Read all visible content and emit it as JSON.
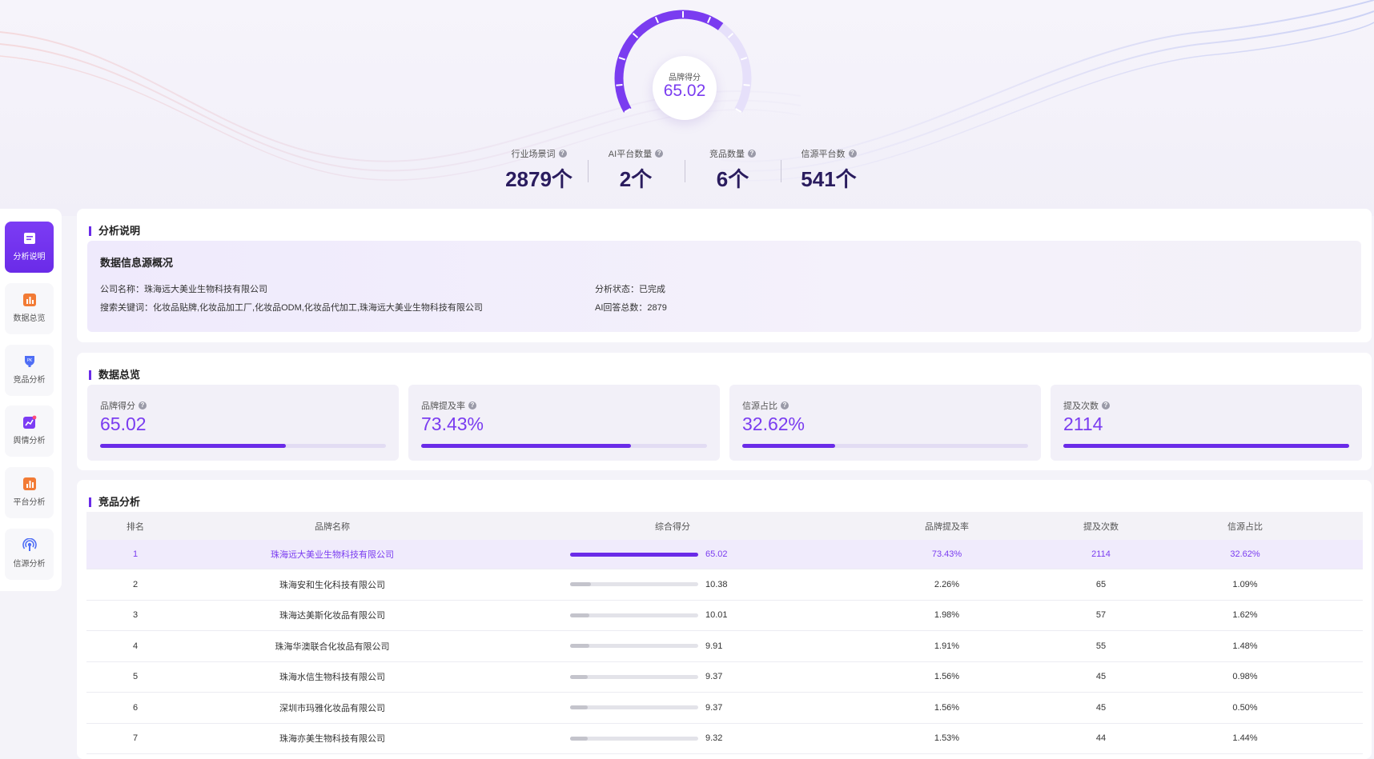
{
  "gauge": {
    "label": "品牌得分",
    "value": "65.02",
    "score": 65.02,
    "max": 100
  },
  "stats": [
    {
      "label": "行业场景词",
      "value": "2879个"
    },
    {
      "label": "AI平台数量",
      "value": "2个"
    },
    {
      "label": "竞品数量",
      "value": "6个"
    },
    {
      "label": "信源平台数",
      "value": "541个"
    }
  ],
  "nav": [
    {
      "label": "分析说明",
      "icon": "document-icon",
      "color": "#7c3cf4"
    },
    {
      "label": "数据总览",
      "icon": "bar-chart-icon",
      "color": "#f27b35"
    },
    {
      "label": "竞品分析",
      "icon": "pk-trophy-icon",
      "color": "#4f6ef5"
    },
    {
      "label": "舆情分析",
      "icon": "trend-icon",
      "color": "#7c3cf4"
    },
    {
      "label": "平台分析",
      "icon": "platform-chart-icon",
      "color": "#f27b35"
    },
    {
      "label": "信源分析",
      "icon": "broadcast-icon",
      "color": "#4f6ef5"
    }
  ],
  "analysis": {
    "title": "分析说明",
    "box_title": "数据信息源概况",
    "company": "公司名称：珠海远大美业生物科技有限公司",
    "keywords": "搜索关键词：化妆品贴牌,化妆品加工厂,化妆品ODM,化妆品代加工,珠海远大美业生物科技有限公司",
    "status": "分析状态：已完成",
    "answers": "AI回答总数：2879"
  },
  "overview": {
    "title": "数据总览",
    "cards": [
      {
        "label": "品牌得分",
        "value": "65.02",
        "progress": 0.65
      },
      {
        "label": "品牌提及率",
        "value": "73.43%",
        "progress": 0.7343
      },
      {
        "label": "信源占比",
        "value": "32.62%",
        "progress": 0.3262
      },
      {
        "label": "提及次数",
        "value": "2114",
        "progress": 1.0
      }
    ]
  },
  "competitors": {
    "title": "竞品分析",
    "headers": [
      "排名",
      "品牌名称",
      "综合得分",
      "品牌提及率",
      "提及次数",
      "信源占比"
    ],
    "rows": [
      {
        "rank": "1",
        "name": "珠海远大美业生物科技有限公司",
        "score": "65.02",
        "score_fraction": 1.0,
        "rate": "73.43%",
        "count": "2114",
        "source": "32.62%"
      },
      {
        "rank": "2",
        "name": "珠海安和生化科技有限公司",
        "score": "10.38",
        "score_fraction": 0.16,
        "rate": "2.26%",
        "count": "65",
        "source": "1.09%"
      },
      {
        "rank": "3",
        "name": "珠海达美斯化妆品有限公司",
        "score": "10.01",
        "score_fraction": 0.15,
        "rate": "1.98%",
        "count": "57",
        "source": "1.62%"
      },
      {
        "rank": "4",
        "name": "珠海华澳联合化妆品有限公司",
        "score": "9.91",
        "score_fraction": 0.15,
        "rate": "1.91%",
        "count": "55",
        "source": "1.48%"
      },
      {
        "rank": "5",
        "name": "珠海水信生物科技有限公司",
        "score": "9.37",
        "score_fraction": 0.14,
        "rate": "1.56%",
        "count": "45",
        "source": "0.98%"
      },
      {
        "rank": "6",
        "name": "深圳市玛雅化妆品有限公司",
        "score": "9.37",
        "score_fraction": 0.14,
        "rate": "1.56%",
        "count": "45",
        "source": "0.50%"
      },
      {
        "rank": "7",
        "name": "珠海亦美生物科技有限公司",
        "score": "9.32",
        "score_fraction": 0.14,
        "rate": "1.53%",
        "count": "44",
        "source": "1.44%"
      }
    ]
  }
}
